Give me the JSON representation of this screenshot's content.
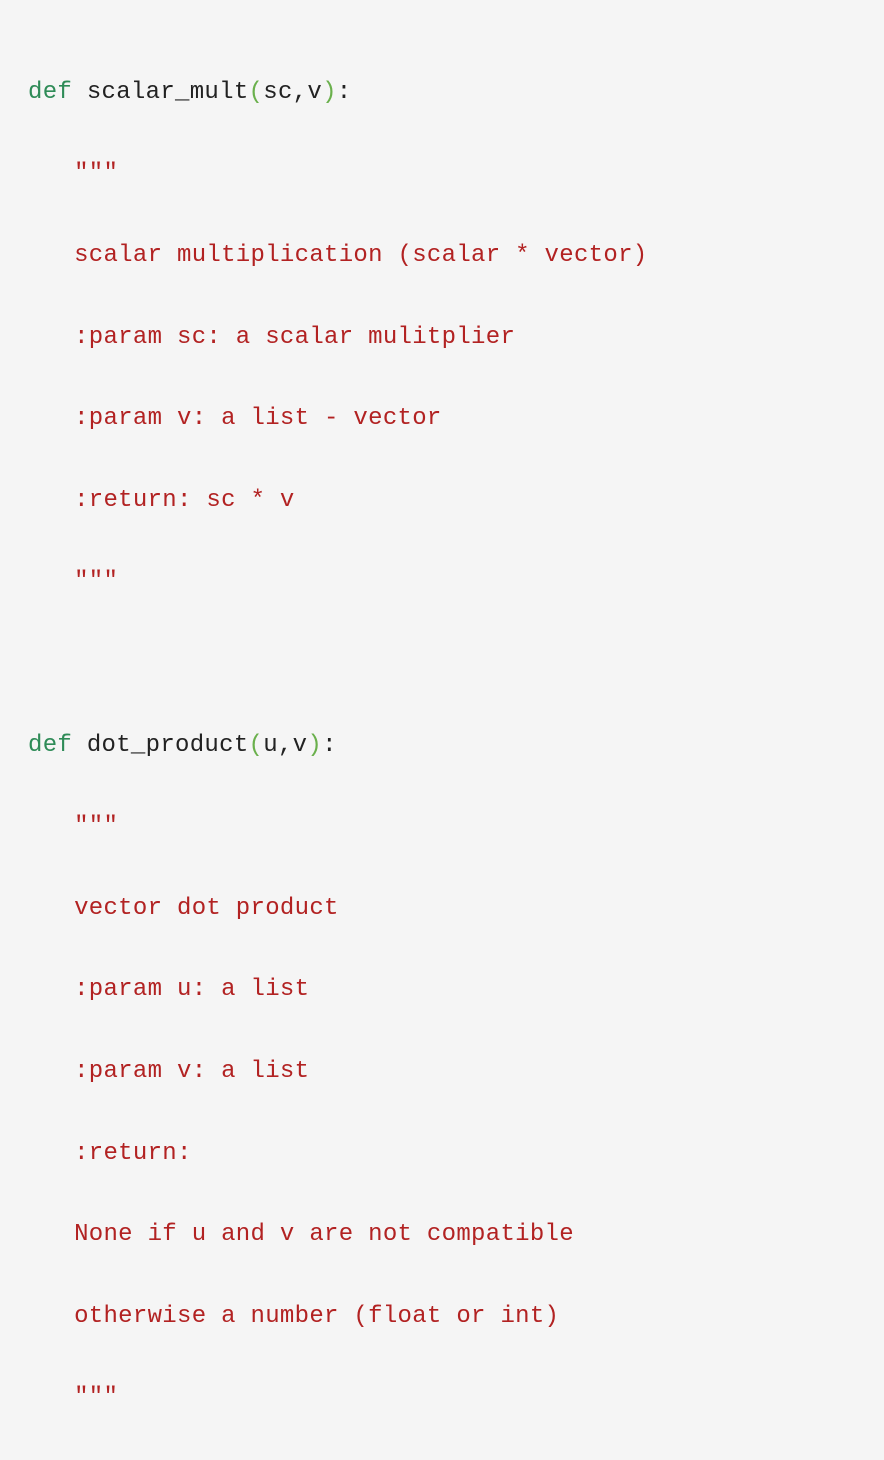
{
  "code": {
    "func1": {
      "def_kw": "def",
      "name": "scalar_mult",
      "paren_open": "(",
      "params": "sc,v",
      "paren_close": ")",
      "colon": ":",
      "doc_open": "\"\"\"",
      "doc_line1": "scalar multiplication (scalar * vector)",
      "doc_line2": ":param sc: a scalar mulitplier",
      "doc_line3": ":param v: a list - vector",
      "doc_line4": ":return: sc * v",
      "doc_close": "\"\"\""
    },
    "func2": {
      "def_kw": "def",
      "name": "dot_product",
      "paren_open": "(",
      "params": "u,v",
      "paren_close": ")",
      "colon": ":",
      "doc_open": "\"\"\"",
      "doc_line1": "vector dot product",
      "doc_line2": ":param u: a list",
      "doc_line3": ":param v: a list",
      "doc_line4": ":return:",
      "doc_line5": "None if u and v are not compatible",
      "doc_line6": "otherwise a number (float or int)",
      "doc_close": "\"\"\""
    }
  }
}
